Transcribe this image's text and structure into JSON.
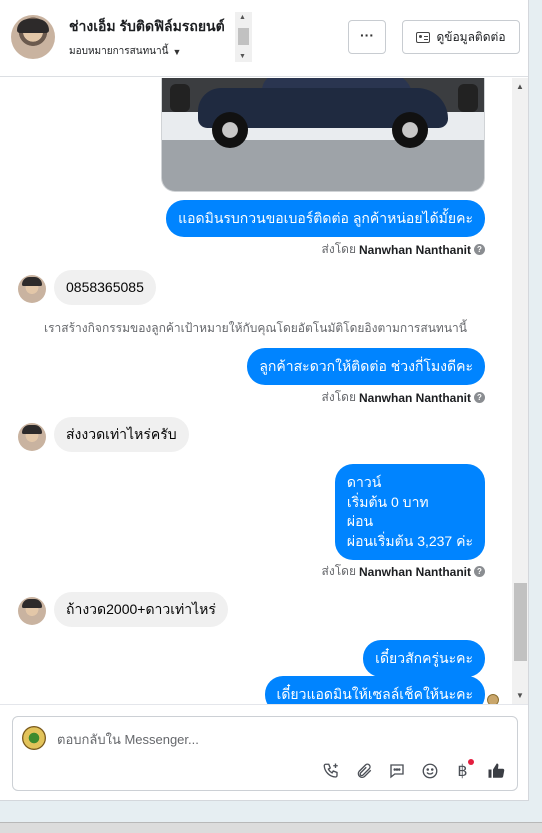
{
  "header": {
    "contact_name": "ช่างเอ็ม รับติดฟิล์มรถยนต์",
    "assign_label": "มอบหมายการสนทนานี้",
    "more_label": "···",
    "contact_info_label": "ดูข้อมูลติดต่อ"
  },
  "messages": [
    {
      "type": "outgoing",
      "text": "แอดมินรบกวนขอเบอร์ติดต่อ ลูกค้าหน่อยได้มั้ยคะ"
    },
    {
      "type": "sent_by",
      "prefix": "ส่งโดย",
      "name": "Nanwhan Nanthanit"
    },
    {
      "type": "incoming",
      "text": "0858365085"
    },
    {
      "type": "system",
      "text": "เราสร้างกิจกรรมของลูกค้าเป้าหมายให้กับคุณโดยอัตโนมัติโดยอิงตามการสนทนานี้"
    },
    {
      "type": "outgoing",
      "text": "ลูกค้าสะดวกให้ติดต่อ ช่วงกี่โมงดีคะ"
    },
    {
      "type": "sent_by",
      "prefix": "ส่งโดย",
      "name": "Nanwhan Nanthanit"
    },
    {
      "type": "incoming",
      "text": "ส่งงวดเท่าไหร่ครับ"
    },
    {
      "type": "outgoing_multi",
      "lines": [
        "ดาวน์",
        "เริ่มต้น 0 บาท",
        "ผ่อน",
        "ผ่อนเริ่มต้น 3,237 ค่ะ"
      ]
    },
    {
      "type": "sent_by",
      "prefix": "ส่งโดย",
      "name": "Nanwhan Nanthanit"
    },
    {
      "type": "incoming",
      "text": "ถ้างวด2000+ดาวเท่าไหร่"
    },
    {
      "type": "outgoing",
      "text": "เดี๋ยวสักครู่นะคะ"
    },
    {
      "type": "outgoing",
      "text": "เดี๋ยวแอดมินให้เซลล์เช็คให้นะคะ"
    }
  ],
  "composer": {
    "placeholder": "ตอบกลับใน Messenger..."
  },
  "icons": [
    "phone-add-icon",
    "attach-icon",
    "saved-reply-icon",
    "emoji-icon",
    "baht-icon",
    "thumbs-up-icon"
  ],
  "colors": {
    "outgoing_bubble": "#0084ff",
    "incoming_bubble": "#f0f0f0",
    "notification_dot": "#e41e3f"
  }
}
